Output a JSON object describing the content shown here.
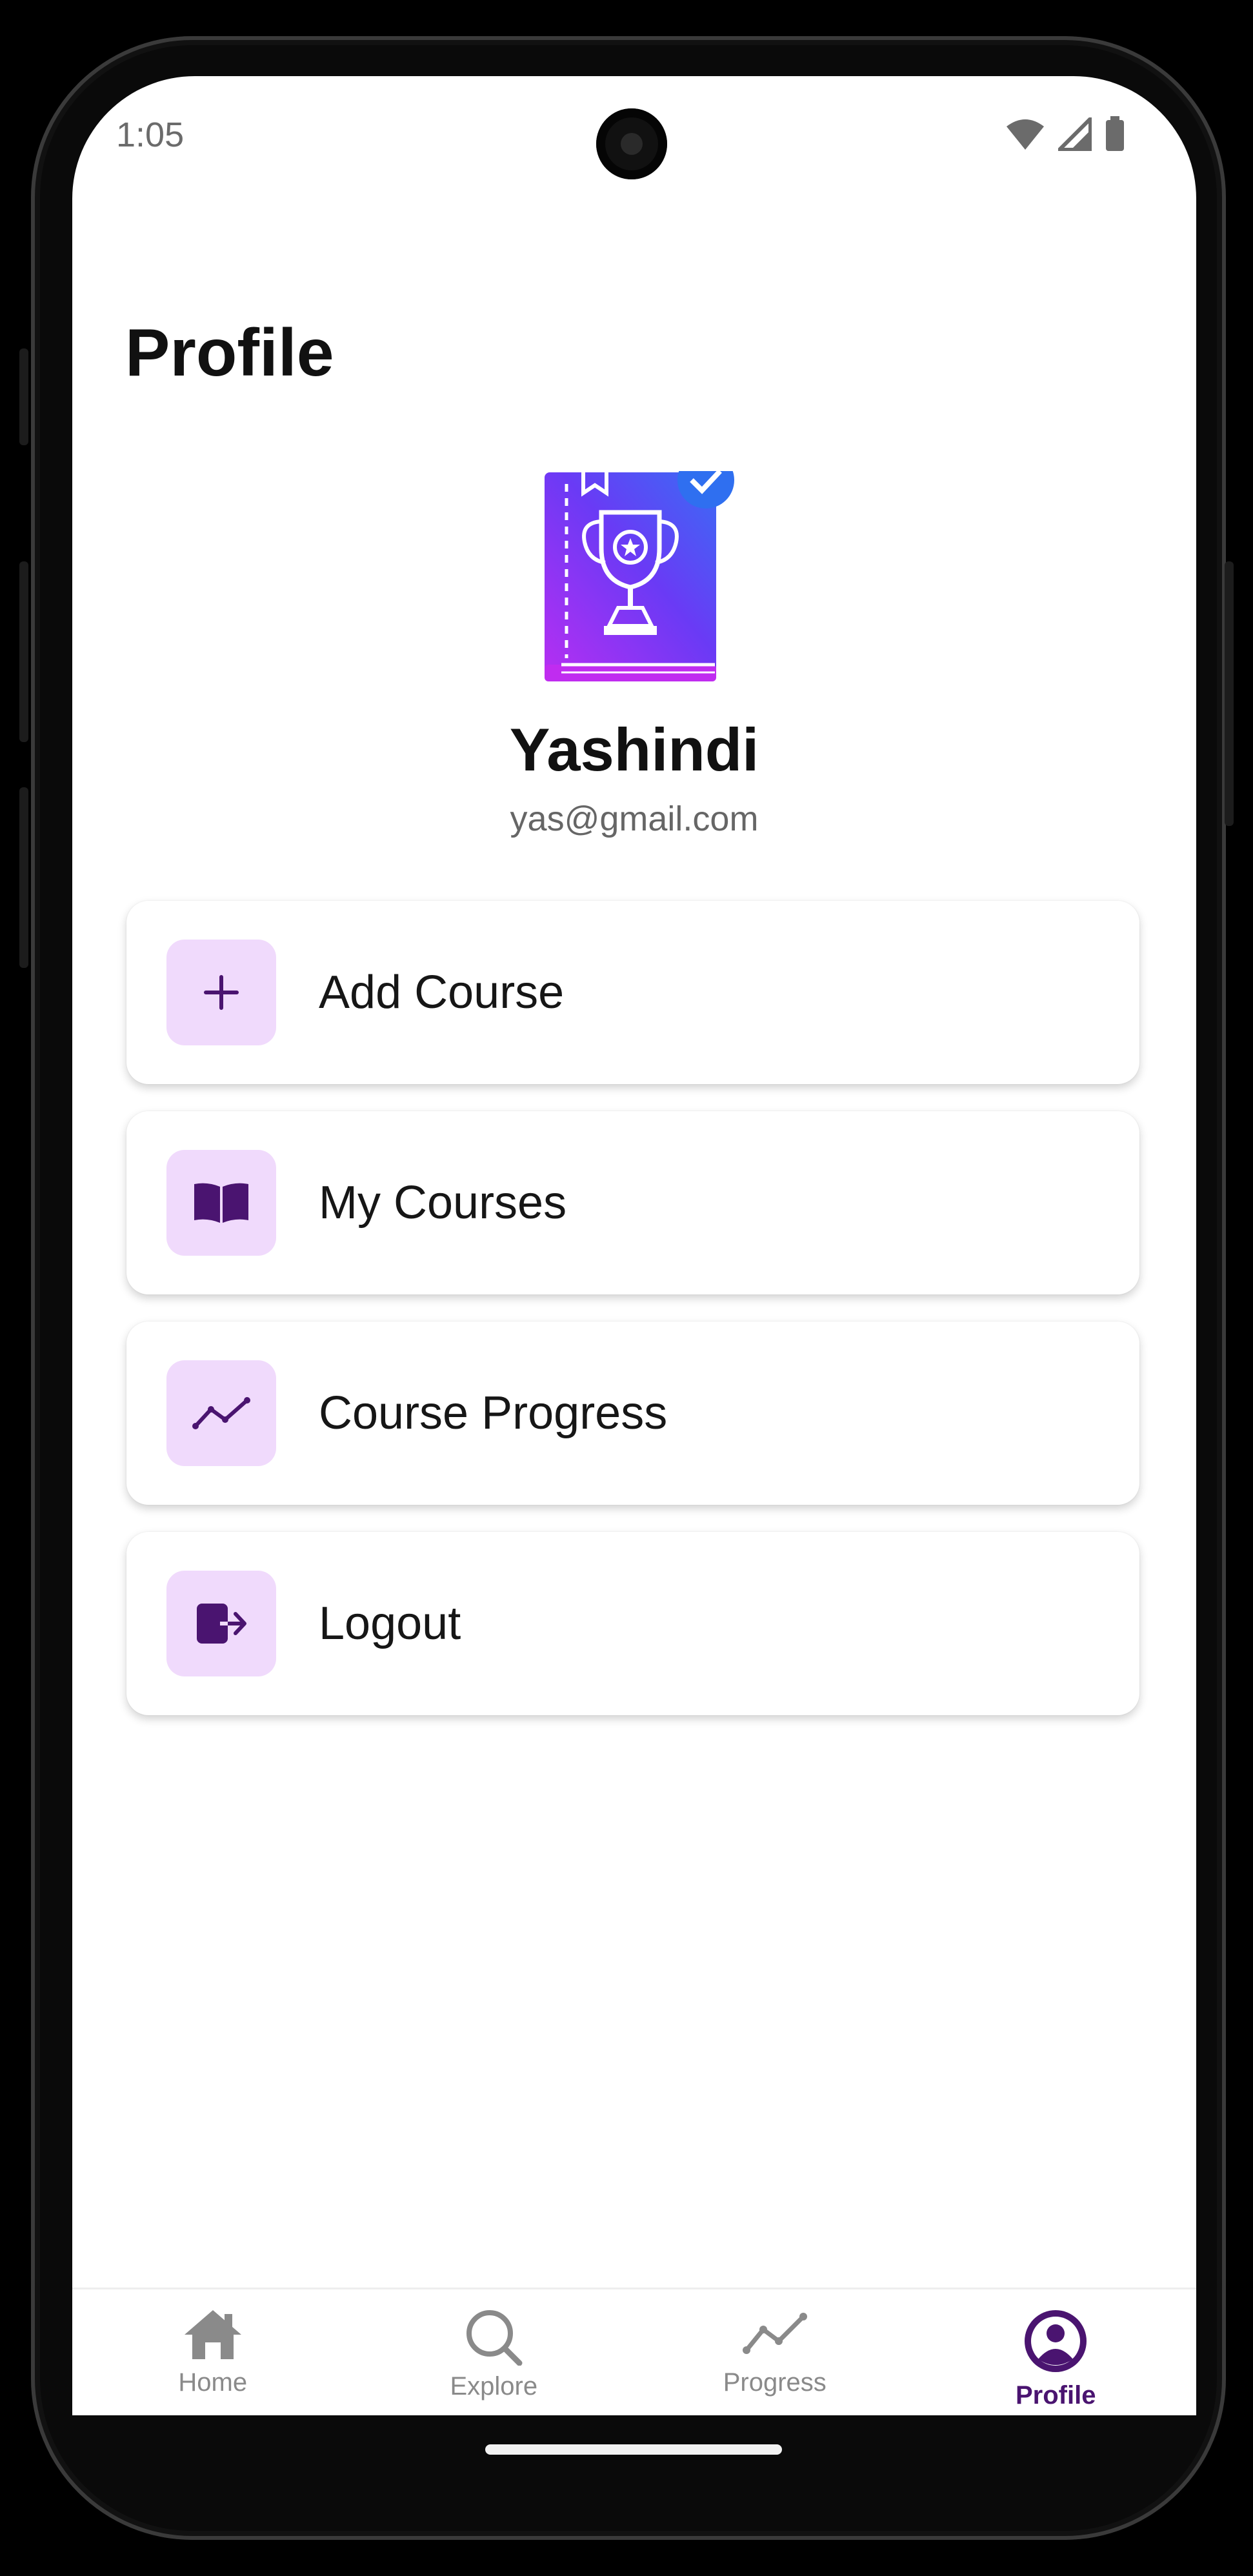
{
  "status_bar": {
    "time": "1:05"
  },
  "header": {
    "title": "Profile"
  },
  "user": {
    "name": "Yashindi",
    "email": "yas@gmail.com"
  },
  "menu": [
    {
      "label": "Add Course",
      "icon": "plus-icon"
    },
    {
      "label": "My Courses",
      "icon": "book-icon"
    },
    {
      "label": "Course Progress",
      "icon": "trend-line-icon"
    },
    {
      "label": "Logout",
      "icon": "logout-icon"
    }
  ],
  "bottom_nav": [
    {
      "label": "Home",
      "icon": "home-icon",
      "active": false
    },
    {
      "label": "Explore",
      "icon": "search-icon",
      "active": false
    },
    {
      "label": "Progress",
      "icon": "trend-line-icon",
      "active": false
    },
    {
      "label": "Profile",
      "icon": "user-circle-icon",
      "active": true
    }
  ],
  "colors": {
    "accent": "#4a1470",
    "icon_bg": "#f0dafc",
    "avatar_gradient_start": "#7b2ff7",
    "avatar_gradient_end": "#2a6ef5"
  }
}
